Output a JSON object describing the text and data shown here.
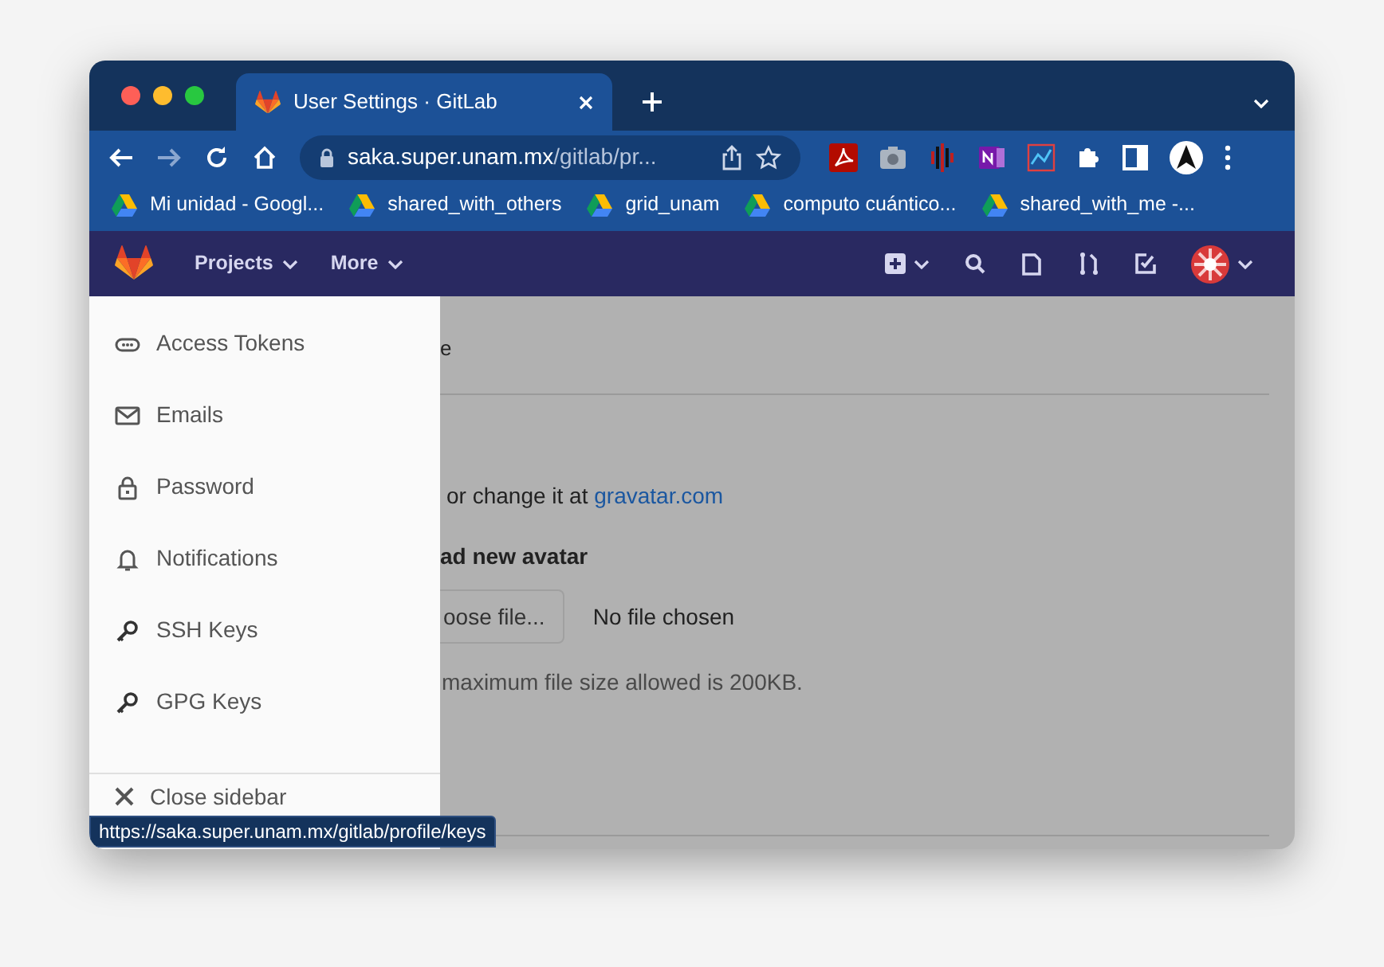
{
  "tab": {
    "title": "User Settings · GitLab"
  },
  "address": {
    "host": "saka.super.unam.mx",
    "path": "/gitlab/pr..."
  },
  "bookmarks": [
    "Mi unidad - Googl...",
    "shared_with_others",
    "grid_unam",
    "computo cuántico...",
    "shared_with_me -..."
  ],
  "nav": {
    "menus": [
      "Projects",
      "More"
    ]
  },
  "sidebar": {
    "items": [
      {
        "label": "Access Tokens",
        "kind": "token"
      },
      {
        "label": "Emails",
        "kind": "mail"
      },
      {
        "label": "Password",
        "kind": "lock"
      },
      {
        "label": "Notifications",
        "kind": "bell"
      },
      {
        "label": "SSH Keys",
        "kind": "key"
      },
      {
        "label": "GPG Keys",
        "kind": "key"
      }
    ],
    "close": "Close sidebar"
  },
  "content": {
    "heading_fragment": "e",
    "gravatar_text": "or change it at",
    "gravatar_link": "gravatar.com",
    "upload_label": "ad new avatar",
    "choose_button": "oose file...",
    "file_status": "No file chosen",
    "size_note": "maximum file size allowed is 200KB."
  },
  "status_url": "https://saka.super.unam.mx/gitlab/profile/keys"
}
